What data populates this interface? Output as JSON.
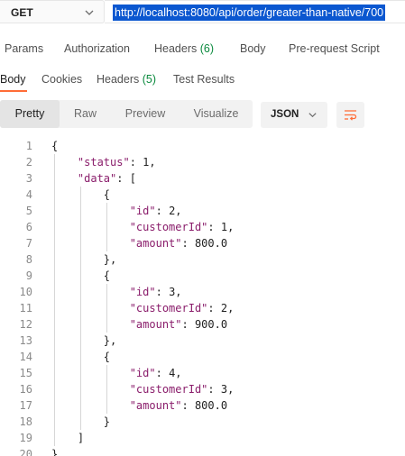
{
  "request": {
    "method": "GET",
    "url": "http://localhost:8080/api/order/greater-than-native/700"
  },
  "request_tabs": {
    "params": "Params",
    "authorization": "Authorization",
    "headers": "Headers",
    "headers_count": "(6)",
    "body": "Body",
    "pre_request_script": "Pre-request Script"
  },
  "response_tabs": {
    "body": "Body",
    "cookies": "Cookies",
    "headers": "Headers",
    "headers_count": "(5)",
    "test_results": "Test Results"
  },
  "view_modes": {
    "pretty": "Pretty",
    "raw": "Raw",
    "preview": "Preview",
    "visualize": "Visualize",
    "format": "JSON"
  },
  "code_lines": [
    {
      "num": "1",
      "text": "{"
    },
    {
      "num": "2",
      "text": "    \"status\": 1,"
    },
    {
      "num": "3",
      "text": "    \"data\": ["
    },
    {
      "num": "4",
      "text": "        {"
    },
    {
      "num": "5",
      "text": "            \"id\": 2,"
    },
    {
      "num": "6",
      "text": "            \"customerId\": 1,"
    },
    {
      "num": "7",
      "text": "            \"amount\": 800.0"
    },
    {
      "num": "8",
      "text": "        },"
    },
    {
      "num": "9",
      "text": "        {"
    },
    {
      "num": "10",
      "text": "            \"id\": 3,"
    },
    {
      "num": "11",
      "text": "            \"customerId\": 2,"
    },
    {
      "num": "12",
      "text": "            \"amount\": 900.0"
    },
    {
      "num": "13",
      "text": "        },"
    },
    {
      "num": "14",
      "text": "        {"
    },
    {
      "num": "15",
      "text": "            \"id\": 4,"
    },
    {
      "num": "16",
      "text": "            \"customerId\": 3,"
    },
    {
      "num": "17",
      "text": "            \"amount\": 800.0"
    },
    {
      "num": "18",
      "text": "        }"
    },
    {
      "num": "19",
      "text": "    ]"
    },
    {
      "num": "20",
      "text": "}"
    }
  ],
  "colors": {
    "accent": "#ff6c37",
    "selection": "#0b57d0",
    "json_key": "#8a1d6b",
    "json_number": "#0b7a5c",
    "count_green": "#0b8a3e"
  }
}
